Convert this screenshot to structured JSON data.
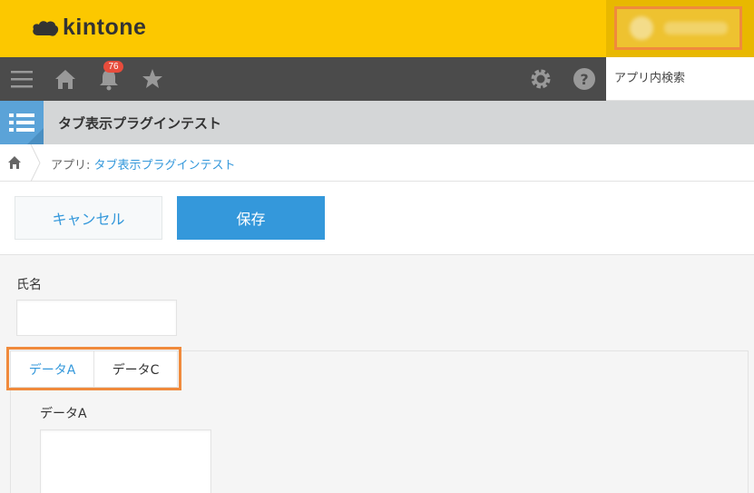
{
  "header": {
    "logo_text": "kintone",
    "colors": {
      "brand_yellow": "#fcc800",
      "highlight_orange": "#f08a3c",
      "accent_blue": "#3498db"
    }
  },
  "nav": {
    "notification_count": "76",
    "icons": [
      "menu-icon",
      "home-icon",
      "bell-icon",
      "star-icon",
      "gear-icon",
      "help-icon"
    ],
    "search_placeholder": "アプリ内検索"
  },
  "app": {
    "title": "タブ表示プラグインテスト"
  },
  "breadcrumb": {
    "prefix": "アプリ: ",
    "app_link": "タブ表示プラグインテスト"
  },
  "toolbar": {
    "cancel_label": "キャンセル",
    "save_label": "保存"
  },
  "form": {
    "name_label": "氏名",
    "name_value": "",
    "tabs": [
      {
        "label": "データA",
        "active": true
      },
      {
        "label": "データC",
        "active": false
      }
    ],
    "data_a_label": "データA",
    "data_a_value": ""
  }
}
